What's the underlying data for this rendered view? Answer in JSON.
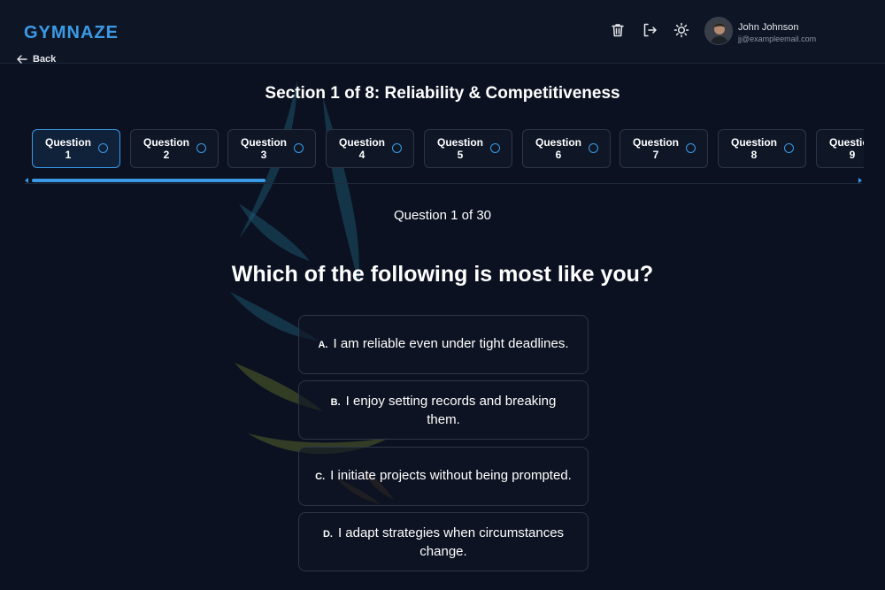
{
  "app": {
    "logo": "GYMNAZE"
  },
  "header": {
    "back_label": "Back",
    "user": {
      "name": "John Johnson",
      "email": "jj@exampleemail.com"
    },
    "icons": [
      "trash-icon",
      "logout-icon",
      "sun-icon"
    ]
  },
  "section": {
    "title": "Section 1 of 8: Reliability & Competitiveness"
  },
  "question_nav": {
    "tabs": [
      {
        "label": "Question",
        "number": "1",
        "active": true
      },
      {
        "label": "Question",
        "number": "2",
        "active": false
      },
      {
        "label": "Question",
        "number": "3",
        "active": false
      },
      {
        "label": "Question",
        "number": "4",
        "active": false
      },
      {
        "label": "Question",
        "number": "5",
        "active": false
      },
      {
        "label": "Question",
        "number": "6",
        "active": false
      },
      {
        "label": "Question",
        "number": "7",
        "active": false
      },
      {
        "label": "Question",
        "number": "8",
        "active": false
      },
      {
        "label": "Question",
        "number": "9",
        "active": false
      }
    ],
    "scroll_fraction_visible": 0.28
  },
  "counter": "Question 1 of 30",
  "question": "Which of the following is most like you?",
  "answers": [
    {
      "letter": "A.",
      "text": "I am reliable even under tight deadlines."
    },
    {
      "letter": "B.",
      "text": "I enjoy setting records and breaking them."
    },
    {
      "letter": "C.",
      "text": "I initiate projects without being prompted."
    },
    {
      "letter": "D.",
      "text": "I adapt strategies when circumstances change."
    }
  ],
  "colors": {
    "accent": "#3b9ae6",
    "background": "#0b1120"
  }
}
